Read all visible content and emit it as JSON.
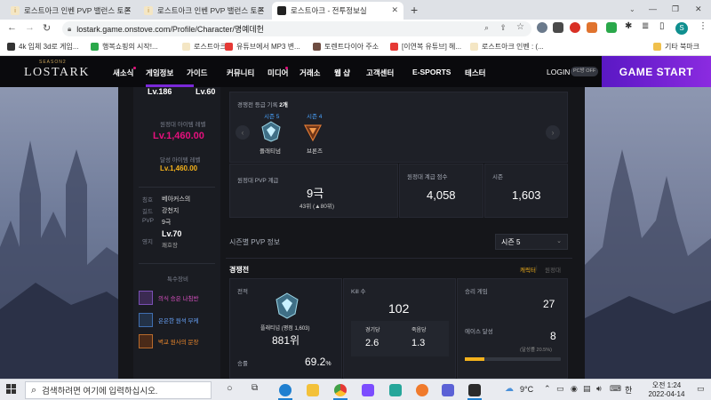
{
  "tabs": [
    {
      "label": "로스트아크 인벤 PVP 밸런스 토론"
    },
    {
      "label": "로스트아크 인벤 PVP 밸런스 토론"
    },
    {
      "label": "로스트아크 - 전투정보실"
    }
  ],
  "url": "lostark.game.onstove.com/Profile/Character/명예데헌",
  "bookmarks": [
    "4k 입체 3d로 게임...",
    "행복쇼핑의 시작!...",
    "로스트아크",
    "유튜브에서 MP3 변...",
    "토렌트다이아 주소",
    "[이연복 유튜브] 헤...",
    "로스트아크 인벤 : (...",
    "기타 북마크"
  ],
  "site": {
    "logo_top": "SEASON2",
    "logo": "LOSTARK",
    "nav": [
      "새소식",
      "게임정보",
      "가이드",
      "커뮤니티",
      "미디어",
      "거래소",
      "웹 샵",
      "고객센터",
      "E-SPORTS",
      "테스터"
    ],
    "login": "LOGIN",
    "pcbang": "PC방 OFF",
    "game_start": "GAME START"
  },
  "profile": {
    "top_levels": {
      "a": "Lv.186",
      "b": "Lv.60"
    },
    "equip_label": "원정대 아이템 레벨",
    "equip_value": "Lv.1,460.00",
    "reach_label": "달성 아이템 레벨",
    "reach_value": "Lv.1,460.00",
    "rows": [
      {
        "k": "칭호",
        "v": "베아커스의"
      },
      {
        "k": "길드",
        "v": "강천지"
      },
      {
        "k": "PVP",
        "v": "9극"
      },
      {
        "k": "영지",
        "v": "Lv.70"
      }
    ],
    "estate": "쾌호장",
    "special_title": "특수장비",
    "items": [
      {
        "name": "의식 승은 나침반",
        "color": "#e052c8"
      },
      {
        "name": "은은한 원석 부케",
        "color": "#6aa6ff"
      },
      {
        "name": "벽교 원사의 문장",
        "color": "#f0892c"
      }
    ]
  },
  "competitive": {
    "tier_header": "경쟁전 등급 기록",
    "tier_count": "2개",
    "seasons": [
      {
        "season": "시즌 5",
        "tier": "플래티넘"
      },
      {
        "season": "시즌 4",
        "tier": "브론즈"
      }
    ],
    "pvp_rank_label": "원정대 PVP 계급",
    "pvp_rank": "9극",
    "pvp_rank_sub": "43위 (▲80위)",
    "score_label": "원정대 계급 점수",
    "score": "4,058",
    "season_label": "시즌",
    "season_value": "1,603"
  },
  "season_pvp": {
    "title": "시즌별 PVP 정보",
    "dropdown": "시즌 5",
    "section": "경쟁전",
    "tab_character": "캐릭터",
    "tab_expedition": "원정대",
    "record_label": "전적",
    "tier_text": "플래티넘 (평점 1,603)",
    "rank": "881위",
    "winrate_label": "승률",
    "winrate": "69.2",
    "winrate_unit": "%",
    "kill_label": "Kill 수",
    "kills": "102",
    "per_game_label": "경기당",
    "per_game": "2.6",
    "per_death_label": "죽음당",
    "per_death": "1.3",
    "wins_label": "승리 게임",
    "wins": "27",
    "ace_label": "에이스 달성",
    "ace": "8",
    "ace_sub": "(달성률 20.5%)",
    "ace_ratio": 0.205
  },
  "taskbar": {
    "search_placeholder": "검색하려면 여기에 입력하십시오.",
    "weather": "9°C",
    "ime": "한",
    "time": "오전 1:24",
    "date": "2022-04-14"
  },
  "colors": {
    "accent": "#e6107e",
    "gold": "#f3b11c",
    "purple": "#7a28d8",
    "nav_bg": "#0a0a0d"
  }
}
